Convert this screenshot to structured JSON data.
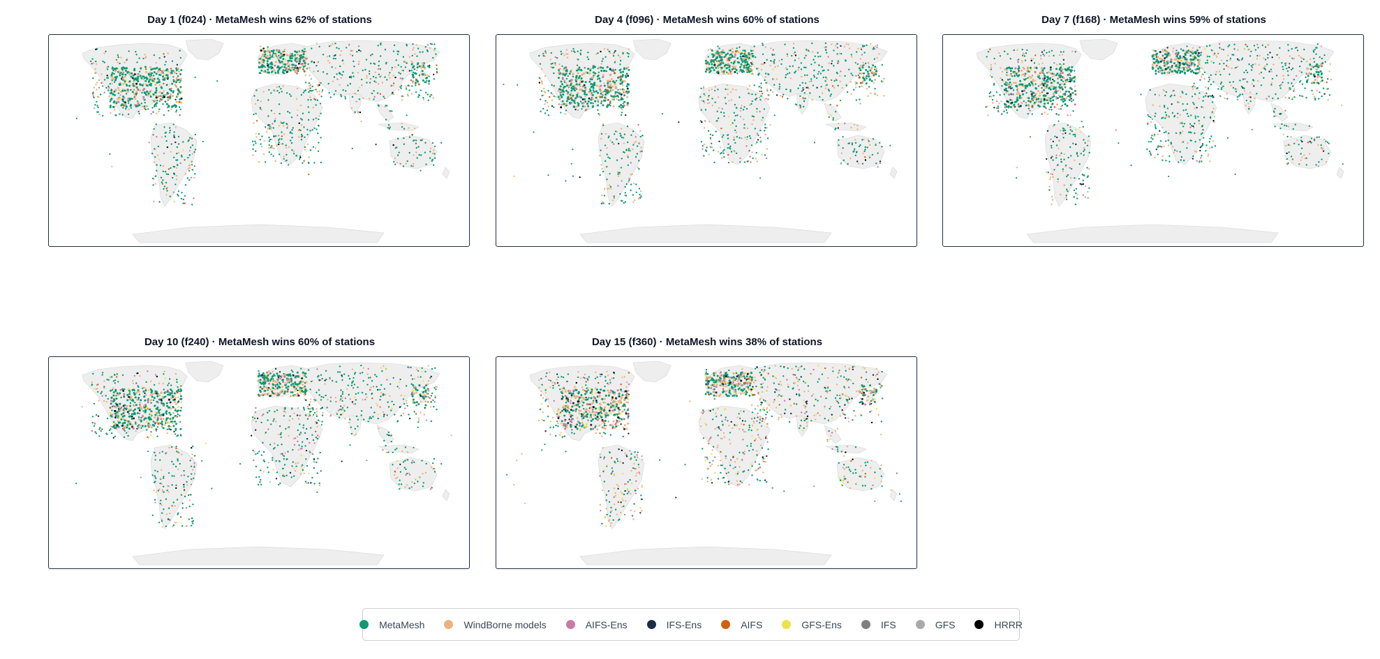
{
  "panels": [
    {
      "title": "Day 1  (f024)  ·  MetaMesh wins 62% of stations",
      "seed": 11,
      "weights": {
        "MetaMesh": 0.62,
        "WindBorne models": 0.26,
        "AIFS-Ens": 0.04,
        "IFS-Ens": 0.02,
        "AIFS": 0.02,
        "GFS-Ens": 0.01,
        "IFS": 0.01,
        "GFS": 0.01,
        "HRRR": 0.01
      }
    },
    {
      "title": "Day 4  (f096)  ·  MetaMesh wins 60% of stations",
      "seed": 23,
      "weights": {
        "MetaMesh": 0.6,
        "WindBorne models": 0.28,
        "AIFS-Ens": 0.05,
        "IFS-Ens": 0.02,
        "AIFS": 0.02,
        "GFS-Ens": 0.01,
        "IFS": 0.01,
        "GFS": 0.005,
        "HRRR": 0.005
      }
    },
    {
      "title": "Day 7  (f168)  ·  MetaMesh wins 59% of stations",
      "seed": 37,
      "weights": {
        "MetaMesh": 0.59,
        "WindBorne models": 0.27,
        "AIFS-Ens": 0.05,
        "IFS-Ens": 0.05,
        "AIFS": 0.01,
        "GFS-Ens": 0.01,
        "IFS": 0.01,
        "GFS": 0.005,
        "HRRR": 0.005
      }
    },
    {
      "title": "Day 10  (f240)  ·  MetaMesh wins 60% of stations",
      "seed": 41,
      "weights": {
        "MetaMesh": 0.6,
        "WindBorne models": 0.22,
        "AIFS-Ens": 0.07,
        "IFS-Ens": 0.04,
        "AIFS": 0.01,
        "GFS-Ens": 0.04,
        "IFS": 0.01,
        "GFS": 0.005,
        "HRRR": 0.005
      }
    },
    {
      "title": "Day 15  (f360)  ·  MetaMesh wins 38% of stations",
      "seed": 53,
      "weights": {
        "MetaMesh": 0.38,
        "WindBorne models": 0.3,
        "AIFS-Ens": 0.09,
        "IFS-Ens": 0.08,
        "AIFS": 0.03,
        "GFS-Ens": 0.07,
        "IFS": 0.02,
        "GFS": 0.02,
        "HRRR": 0.01
      }
    }
  ],
  "legend": [
    {
      "label": "MetaMesh",
      "color": "#0d9a72"
    },
    {
      "label": "WindBorne models",
      "color": "#eab27c"
    },
    {
      "label": "AIFS-Ens",
      "color": "#c97aa6"
    },
    {
      "label": "IFS-Ens",
      "color": "#1c2c44"
    },
    {
      "label": "AIFS",
      "color": "#d0610e"
    },
    {
      "label": "GFS-Ens",
      "color": "#ece24a"
    },
    {
      "label": "IFS",
      "color": "#7f7f7f"
    },
    {
      "label": "GFS",
      "color": "#a9a9a9"
    },
    {
      "label": "HRRR",
      "color": "#000000"
    }
  ]
}
